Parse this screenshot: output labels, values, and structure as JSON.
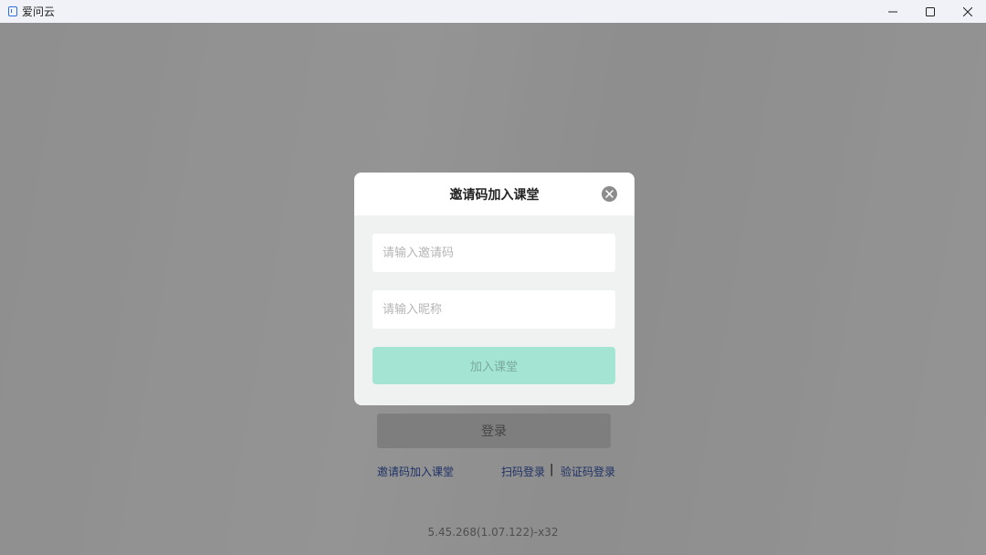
{
  "window": {
    "title": "爱问云",
    "controls": [
      "minimize-icon",
      "maximize-icon",
      "close-icon"
    ]
  },
  "login": {
    "login_button": "登录",
    "links": {
      "invite_join": "邀请码加入课堂",
      "qr_login": "扫码登录",
      "separator": "|",
      "code_login": "验证码登录"
    },
    "version": "5.45.268(1.07.122)-x32"
  },
  "dialog": {
    "title": "邀请码加入课堂",
    "close_icon": "close-icon",
    "invite_code_placeholder": "请输入邀请码",
    "nickname_placeholder": "请输入昵称",
    "join_button": "加入课堂"
  },
  "colors": {
    "accent": "#a3e4d3",
    "link": "#3556b0",
    "overlay": "#000000"
  }
}
